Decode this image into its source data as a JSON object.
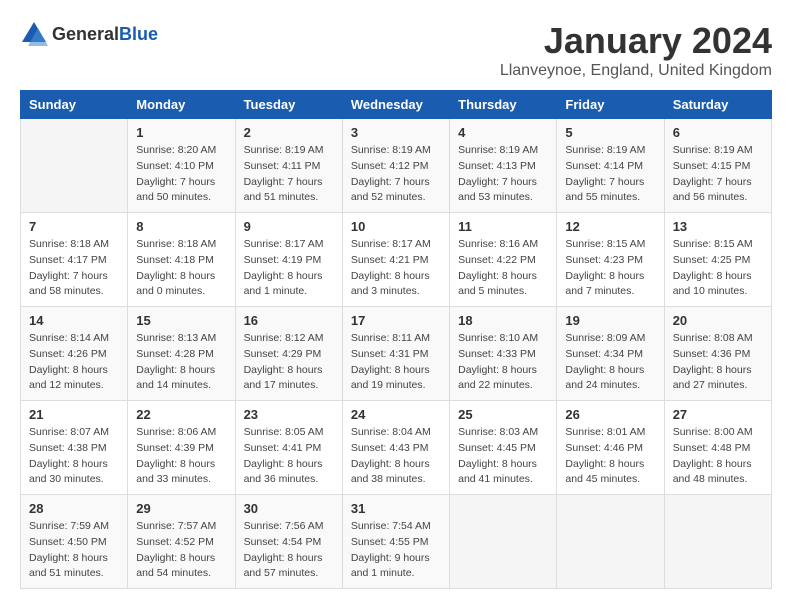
{
  "header": {
    "logo_general": "General",
    "logo_blue": "Blue",
    "month": "January 2024",
    "location": "Llanveynoe, England, United Kingdom"
  },
  "days_of_week": [
    "Sunday",
    "Monday",
    "Tuesday",
    "Wednesday",
    "Thursday",
    "Friday",
    "Saturday"
  ],
  "weeks": [
    [
      {
        "day": "",
        "sunrise": "",
        "sunset": "",
        "daylight": ""
      },
      {
        "day": "1",
        "sunrise": "Sunrise: 8:20 AM",
        "sunset": "Sunset: 4:10 PM",
        "daylight": "Daylight: 7 hours and 50 minutes."
      },
      {
        "day": "2",
        "sunrise": "Sunrise: 8:19 AM",
        "sunset": "Sunset: 4:11 PM",
        "daylight": "Daylight: 7 hours and 51 minutes."
      },
      {
        "day": "3",
        "sunrise": "Sunrise: 8:19 AM",
        "sunset": "Sunset: 4:12 PM",
        "daylight": "Daylight: 7 hours and 52 minutes."
      },
      {
        "day": "4",
        "sunrise": "Sunrise: 8:19 AM",
        "sunset": "Sunset: 4:13 PM",
        "daylight": "Daylight: 7 hours and 53 minutes."
      },
      {
        "day": "5",
        "sunrise": "Sunrise: 8:19 AM",
        "sunset": "Sunset: 4:14 PM",
        "daylight": "Daylight: 7 hours and 55 minutes."
      },
      {
        "day": "6",
        "sunrise": "Sunrise: 8:19 AM",
        "sunset": "Sunset: 4:15 PM",
        "daylight": "Daylight: 7 hours and 56 minutes."
      }
    ],
    [
      {
        "day": "7",
        "sunrise": "Sunrise: 8:18 AM",
        "sunset": "Sunset: 4:17 PM",
        "daylight": "Daylight: 7 hours and 58 minutes."
      },
      {
        "day": "8",
        "sunrise": "Sunrise: 8:18 AM",
        "sunset": "Sunset: 4:18 PM",
        "daylight": "Daylight: 8 hours and 0 minutes."
      },
      {
        "day": "9",
        "sunrise": "Sunrise: 8:17 AM",
        "sunset": "Sunset: 4:19 PM",
        "daylight": "Daylight: 8 hours and 1 minute."
      },
      {
        "day": "10",
        "sunrise": "Sunrise: 8:17 AM",
        "sunset": "Sunset: 4:21 PM",
        "daylight": "Daylight: 8 hours and 3 minutes."
      },
      {
        "day": "11",
        "sunrise": "Sunrise: 8:16 AM",
        "sunset": "Sunset: 4:22 PM",
        "daylight": "Daylight: 8 hours and 5 minutes."
      },
      {
        "day": "12",
        "sunrise": "Sunrise: 8:15 AM",
        "sunset": "Sunset: 4:23 PM",
        "daylight": "Daylight: 8 hours and 7 minutes."
      },
      {
        "day": "13",
        "sunrise": "Sunrise: 8:15 AM",
        "sunset": "Sunset: 4:25 PM",
        "daylight": "Daylight: 8 hours and 10 minutes."
      }
    ],
    [
      {
        "day": "14",
        "sunrise": "Sunrise: 8:14 AM",
        "sunset": "Sunset: 4:26 PM",
        "daylight": "Daylight: 8 hours and 12 minutes."
      },
      {
        "day": "15",
        "sunrise": "Sunrise: 8:13 AM",
        "sunset": "Sunset: 4:28 PM",
        "daylight": "Daylight: 8 hours and 14 minutes."
      },
      {
        "day": "16",
        "sunrise": "Sunrise: 8:12 AM",
        "sunset": "Sunset: 4:29 PM",
        "daylight": "Daylight: 8 hours and 17 minutes."
      },
      {
        "day": "17",
        "sunrise": "Sunrise: 8:11 AM",
        "sunset": "Sunset: 4:31 PM",
        "daylight": "Daylight: 8 hours and 19 minutes."
      },
      {
        "day": "18",
        "sunrise": "Sunrise: 8:10 AM",
        "sunset": "Sunset: 4:33 PM",
        "daylight": "Daylight: 8 hours and 22 minutes."
      },
      {
        "day": "19",
        "sunrise": "Sunrise: 8:09 AM",
        "sunset": "Sunset: 4:34 PM",
        "daylight": "Daylight: 8 hours and 24 minutes."
      },
      {
        "day": "20",
        "sunrise": "Sunrise: 8:08 AM",
        "sunset": "Sunset: 4:36 PM",
        "daylight": "Daylight: 8 hours and 27 minutes."
      }
    ],
    [
      {
        "day": "21",
        "sunrise": "Sunrise: 8:07 AM",
        "sunset": "Sunset: 4:38 PM",
        "daylight": "Daylight: 8 hours and 30 minutes."
      },
      {
        "day": "22",
        "sunrise": "Sunrise: 8:06 AM",
        "sunset": "Sunset: 4:39 PM",
        "daylight": "Daylight: 8 hours and 33 minutes."
      },
      {
        "day": "23",
        "sunrise": "Sunrise: 8:05 AM",
        "sunset": "Sunset: 4:41 PM",
        "daylight": "Daylight: 8 hours and 36 minutes."
      },
      {
        "day": "24",
        "sunrise": "Sunrise: 8:04 AM",
        "sunset": "Sunset: 4:43 PM",
        "daylight": "Daylight: 8 hours and 38 minutes."
      },
      {
        "day": "25",
        "sunrise": "Sunrise: 8:03 AM",
        "sunset": "Sunset: 4:45 PM",
        "daylight": "Daylight: 8 hours and 41 minutes."
      },
      {
        "day": "26",
        "sunrise": "Sunrise: 8:01 AM",
        "sunset": "Sunset: 4:46 PM",
        "daylight": "Daylight: 8 hours and 45 minutes."
      },
      {
        "day": "27",
        "sunrise": "Sunrise: 8:00 AM",
        "sunset": "Sunset: 4:48 PM",
        "daylight": "Daylight: 8 hours and 48 minutes."
      }
    ],
    [
      {
        "day": "28",
        "sunrise": "Sunrise: 7:59 AM",
        "sunset": "Sunset: 4:50 PM",
        "daylight": "Daylight: 8 hours and 51 minutes."
      },
      {
        "day": "29",
        "sunrise": "Sunrise: 7:57 AM",
        "sunset": "Sunset: 4:52 PM",
        "daylight": "Daylight: 8 hours and 54 minutes."
      },
      {
        "day": "30",
        "sunrise": "Sunrise: 7:56 AM",
        "sunset": "Sunset: 4:54 PM",
        "daylight": "Daylight: 8 hours and 57 minutes."
      },
      {
        "day": "31",
        "sunrise": "Sunrise: 7:54 AM",
        "sunset": "Sunset: 4:55 PM",
        "daylight": "Daylight: 9 hours and 1 minute."
      },
      {
        "day": "",
        "sunrise": "",
        "sunset": "",
        "daylight": ""
      },
      {
        "day": "",
        "sunrise": "",
        "sunset": "",
        "daylight": ""
      },
      {
        "day": "",
        "sunrise": "",
        "sunset": "",
        "daylight": ""
      }
    ]
  ]
}
